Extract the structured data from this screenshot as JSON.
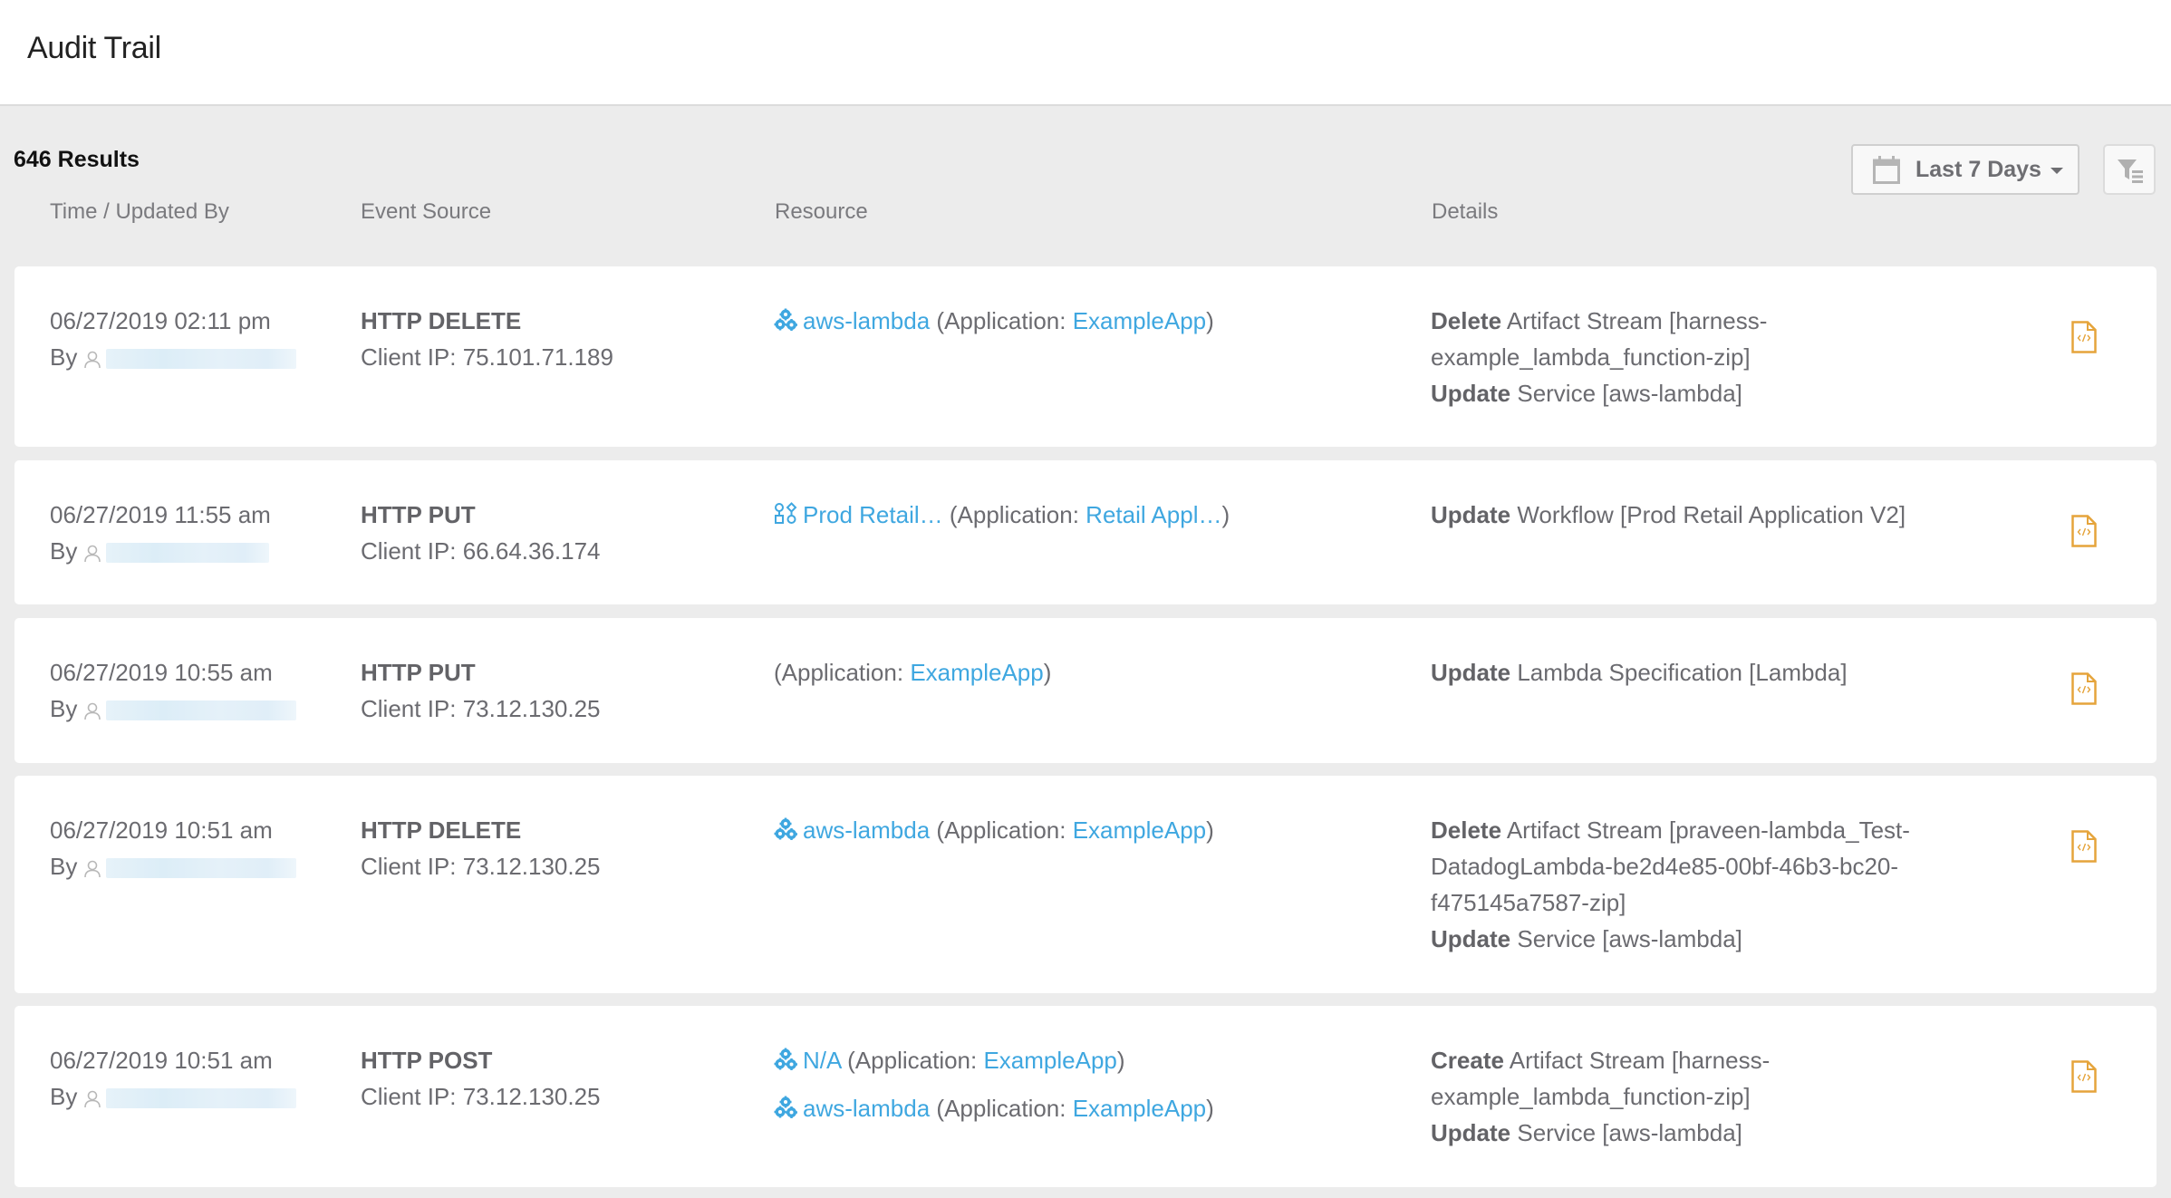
{
  "header": {
    "title": "Audit Trail"
  },
  "toolbar": {
    "results_label": "646 Results",
    "date_range": {
      "selected": "Last 7 Days",
      "icon": "calendar-icon"
    },
    "filter_icon": "filter-icon"
  },
  "columns": [
    "Time / Updated By",
    "Event Source",
    "Resource",
    "Details"
  ],
  "colors": {
    "link": "#3fa7e0",
    "file_icon": "#e5a43b",
    "background": "#ececec"
  },
  "rows": [
    {
      "time": "06/27/2019 02:11 pm",
      "by_label": "By",
      "method": "HTTP DELETE",
      "client_ip": "Client IP: 75.101.71.189",
      "resources": [
        {
          "icon": "service-icon",
          "name": "aws-lambda",
          "app_prefix": "(Application: ",
          "app": "ExampleApp",
          "app_suffix": ")"
        }
      ],
      "details": [
        {
          "action": "Delete",
          "text": " Artifact Stream [harness-example_lambda_function-zip]"
        },
        {
          "action": "Update",
          "text": " Service [aws-lambda]"
        }
      ]
    },
    {
      "time": "06/27/2019 11:55 am",
      "by_label": "By",
      "method": "HTTP PUT",
      "client_ip": "Client IP: 66.64.36.174",
      "resources": [
        {
          "icon": "workflow-icon",
          "name": "Prod Retail…",
          "app_prefix": "(Application: ",
          "app": "Retail Appl…",
          "app_suffix": ")"
        }
      ],
      "details": [
        {
          "action": "Update",
          "text": " Workflow [Prod Retail Application V2]"
        }
      ]
    },
    {
      "time": "06/27/2019 10:55 am",
      "by_label": "By",
      "method": "HTTP PUT",
      "client_ip": "Client IP: 73.12.130.25",
      "resources": [
        {
          "icon": "",
          "name": "",
          "app_prefix": "(Application: ",
          "app": "ExampleApp",
          "app_suffix": ")"
        }
      ],
      "details": [
        {
          "action": "Update",
          "text": " Lambda Specification [Lambda]"
        }
      ]
    },
    {
      "time": "06/27/2019 10:51 am",
      "by_label": "By",
      "method": "HTTP DELETE",
      "client_ip": "Client IP: 73.12.130.25",
      "resources": [
        {
          "icon": "service-icon",
          "name": "aws-lambda",
          "app_prefix": "(Application: ",
          "app": "ExampleApp",
          "app_suffix": ")"
        }
      ],
      "details": [
        {
          "action": "Delete",
          "text": " Artifact Stream [praveen-lambda_Test-DatadogLambda-be2d4e85-00bf-46b3-bc20-f475145a7587-zip]"
        },
        {
          "action": "Update",
          "text": " Service [aws-lambda]"
        }
      ]
    },
    {
      "time": "06/27/2019 10:51 am",
      "by_label": "By",
      "method": "HTTP POST",
      "client_ip": "Client IP: 73.12.130.25",
      "resources": [
        {
          "icon": "service-icon",
          "name": "N/A",
          "app_prefix": "(Application: ",
          "app": "ExampleApp",
          "app_suffix": ")"
        },
        {
          "icon": "service-icon",
          "name": "aws-lambda",
          "app_prefix": "(Application: ",
          "app": "ExampleApp",
          "app_suffix": ")"
        }
      ],
      "details": [
        {
          "action": "Create",
          "text": " Artifact Stream [harness-example_lambda_function-zip]"
        },
        {
          "action": "Update",
          "text": " Service [aws-lambda]"
        }
      ]
    }
  ]
}
